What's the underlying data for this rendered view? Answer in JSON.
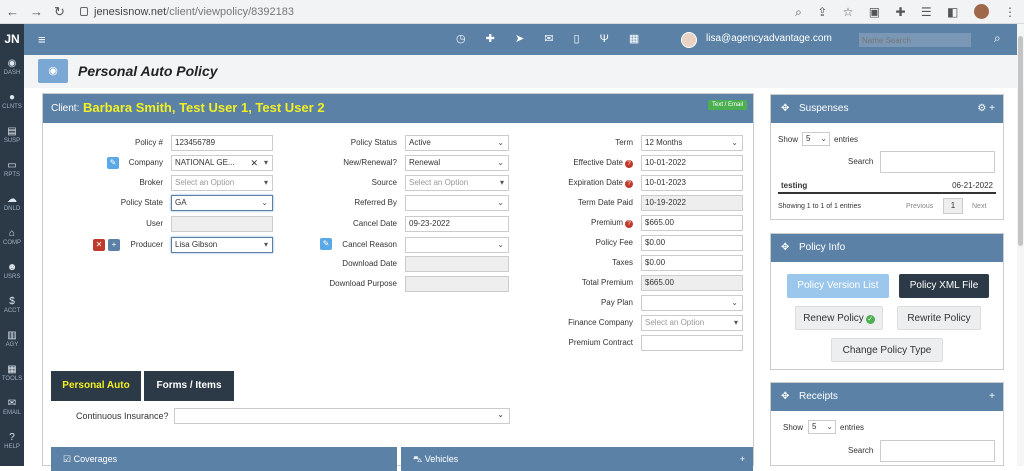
{
  "browser": {
    "url_host": "jenesisnow.net",
    "url_path": "/client/viewpolicy/8392183"
  },
  "sidebar": {
    "logo": "JN",
    "items": [
      {
        "label": "DASH",
        "icon": "dashboard-icon"
      },
      {
        "label": "CLNTS",
        "icon": "globe-icon"
      },
      {
        "label": "SUSP",
        "icon": "suspense-icon"
      },
      {
        "label": "RPTS",
        "icon": "reports-icon"
      },
      {
        "label": "DNLD",
        "icon": "download-icon"
      },
      {
        "label": "COMP",
        "icon": "bank-icon"
      },
      {
        "label": "USRS",
        "icon": "users-icon"
      },
      {
        "label": "ACCT",
        "icon": "dollar-icon"
      },
      {
        "label": "AGY",
        "icon": "building-icon"
      },
      {
        "label": "TOOLS",
        "icon": "tools-icon"
      },
      {
        "label": "EMAIL",
        "icon": "envelope-icon"
      },
      {
        "label": "HELP",
        "icon": "help-icon"
      }
    ]
  },
  "topnav": {
    "user_email": "lisa@agencyadvantage.com",
    "search_placeholder": "Name Search"
  },
  "page": {
    "title": "Personal Auto Policy"
  },
  "client": {
    "label": "Client:",
    "names": "Barbara Smith, Test User 1, Test User 2",
    "badge": "Text / Email"
  },
  "policy": {
    "col1": {
      "policy_no_label": "Policy #",
      "policy_no": "123456789",
      "company_label": "Company",
      "company": "NATIONAL GE...",
      "broker_label": "Broker",
      "broker_placeholder": "Select an Option",
      "state_label": "Policy State",
      "state": "GA",
      "user_label": "User",
      "producer_label": "Producer",
      "producer": "Lisa Gibson"
    },
    "col2": {
      "status_label": "Policy Status",
      "status": "Active",
      "new_renewal_label": "New/Renewal?",
      "new_renewal": "Renewal",
      "source_label": "Source",
      "source_placeholder": "Select an Option",
      "referred_label": "Referred By",
      "cancel_date_label": "Cancel Date",
      "cancel_date": "09-23-2022",
      "cancel_reason_label": "Cancel Reason",
      "download_date_label": "Download Date",
      "download_purpose_label": "Download Purpose"
    },
    "col3": {
      "term_label": "Term",
      "term": "12 Months",
      "eff_label": "Effective Date",
      "eff": "10-01-2022",
      "exp_label": "Expiration Date",
      "exp": "10-01-2023",
      "paid_label": "Term Date Paid",
      "paid": "10-19-2022",
      "premium_label": "Premium",
      "premium": "$665.00",
      "fee_label": "Policy Fee",
      "fee": "$0.00",
      "taxes_label": "Taxes",
      "taxes": "$0.00",
      "total_label": "Total Premium",
      "total": "$665.00",
      "pay_plan_label": "Pay Plan",
      "finance_label": "Finance Company",
      "finance_placeholder": "Select an Option",
      "contract_label": "Premium Contract"
    }
  },
  "tabs": {
    "personal_auto": "Personal Auto",
    "forms_items": "Forms / Items"
  },
  "continuous_label": "Continuous Insurance?",
  "bottom": {
    "coverages": "Coverages",
    "vehicles": "Vehicles"
  },
  "suspenses": {
    "title": "Suspenses",
    "show": "Show",
    "entries_count": "5",
    "entries": "entries",
    "search_label": "Search",
    "row_name": "testing",
    "row_date": "06-21-2022",
    "showing": "Showing 1 to 1 of 1 entries",
    "prev": "Previous",
    "page": "1",
    "next": "Next"
  },
  "policy_info": {
    "title": "Policy Info",
    "version_list": "Policy Version List",
    "xml_file": "Policy XML File",
    "renew": "Renew Policy",
    "rewrite": "Rewrite Policy",
    "change_type": "Change Policy Type"
  },
  "receipts": {
    "title": "Receipts",
    "show": "Show",
    "entries_count": "5",
    "entries": "entries",
    "search_label": "Search"
  }
}
